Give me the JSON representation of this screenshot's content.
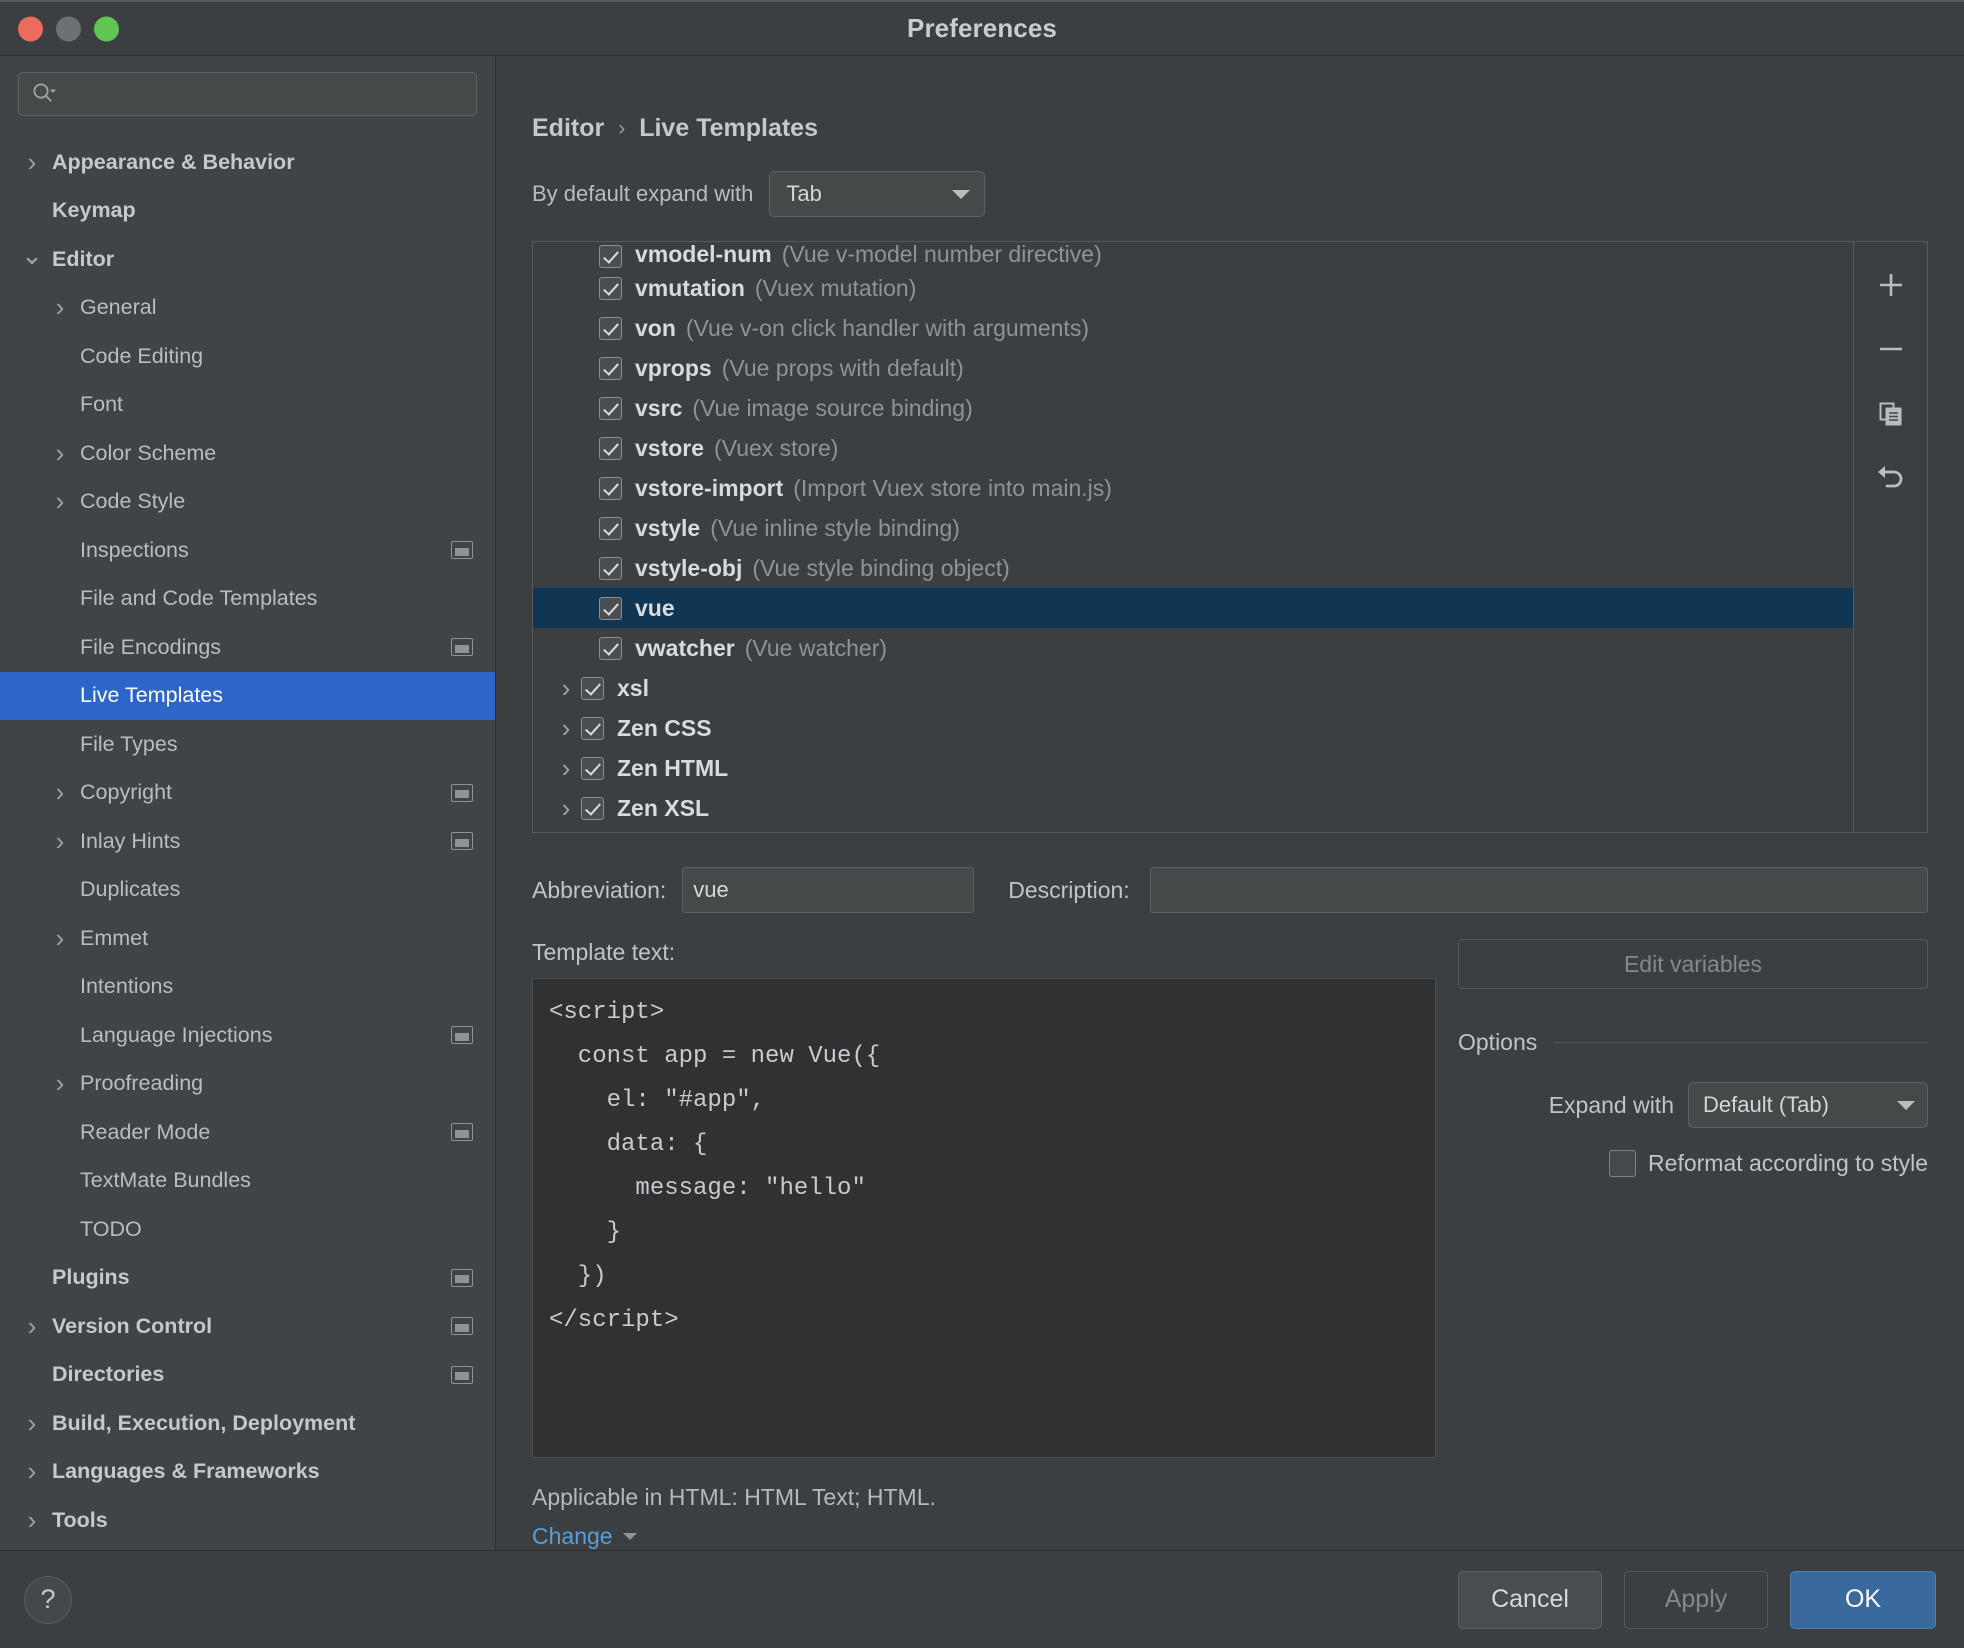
{
  "window": {
    "title": "Preferences",
    "traffic_lights": [
      "close",
      "minimize",
      "zoom"
    ]
  },
  "sidebar": {
    "search": {
      "value": "",
      "placeholder": ""
    },
    "items": [
      {
        "label": "Appearance & Behavior",
        "level": 0,
        "chevron": "right",
        "bold": true,
        "badge": false,
        "selected": false
      },
      {
        "label": "Keymap",
        "level": 0,
        "chevron": "none",
        "bold": true,
        "badge": false,
        "selected": false
      },
      {
        "label": "Editor",
        "level": 0,
        "chevron": "down",
        "bold": true,
        "badge": false,
        "selected": false
      },
      {
        "label": "General",
        "level": 1,
        "chevron": "right",
        "bold": false,
        "badge": false,
        "selected": false
      },
      {
        "label": "Code Editing",
        "level": 1,
        "chevron": "none",
        "bold": false,
        "badge": false,
        "selected": false
      },
      {
        "label": "Font",
        "level": 1,
        "chevron": "none",
        "bold": false,
        "badge": false,
        "selected": false
      },
      {
        "label": "Color Scheme",
        "level": 1,
        "chevron": "right",
        "bold": false,
        "badge": false,
        "selected": false
      },
      {
        "label": "Code Style",
        "level": 1,
        "chevron": "right",
        "bold": false,
        "badge": false,
        "selected": false
      },
      {
        "label": "Inspections",
        "level": 1,
        "chevron": "none",
        "bold": false,
        "badge": true,
        "selected": false
      },
      {
        "label": "File and Code Templates",
        "level": 1,
        "chevron": "none",
        "bold": false,
        "badge": false,
        "selected": false
      },
      {
        "label": "File Encodings",
        "level": 1,
        "chevron": "none",
        "bold": false,
        "badge": true,
        "selected": false
      },
      {
        "label": "Live Templates",
        "level": 1,
        "chevron": "none",
        "bold": false,
        "badge": false,
        "selected": true
      },
      {
        "label": "File Types",
        "level": 1,
        "chevron": "none",
        "bold": false,
        "badge": false,
        "selected": false
      },
      {
        "label": "Copyright",
        "level": 1,
        "chevron": "right",
        "bold": false,
        "badge": true,
        "selected": false
      },
      {
        "label": "Inlay Hints",
        "level": 1,
        "chevron": "right",
        "bold": false,
        "badge": true,
        "selected": false
      },
      {
        "label": "Duplicates",
        "level": 1,
        "chevron": "none",
        "bold": false,
        "badge": false,
        "selected": false
      },
      {
        "label": "Emmet",
        "level": 1,
        "chevron": "right",
        "bold": false,
        "badge": false,
        "selected": false
      },
      {
        "label": "Intentions",
        "level": 1,
        "chevron": "none",
        "bold": false,
        "badge": false,
        "selected": false
      },
      {
        "label": "Language Injections",
        "level": 1,
        "chevron": "none",
        "bold": false,
        "badge": true,
        "selected": false
      },
      {
        "label": "Proofreading",
        "level": 1,
        "chevron": "right",
        "bold": false,
        "badge": false,
        "selected": false
      },
      {
        "label": "Reader Mode",
        "level": 1,
        "chevron": "none",
        "bold": false,
        "badge": true,
        "selected": false
      },
      {
        "label": "TextMate Bundles",
        "level": 1,
        "chevron": "none",
        "bold": false,
        "badge": false,
        "selected": false
      },
      {
        "label": "TODO",
        "level": 1,
        "chevron": "none",
        "bold": false,
        "badge": false,
        "selected": false
      },
      {
        "label": "Plugins",
        "level": 0,
        "chevron": "none",
        "bold": true,
        "badge": true,
        "selected": false
      },
      {
        "label": "Version Control",
        "level": 0,
        "chevron": "right",
        "bold": true,
        "badge": true,
        "selected": false
      },
      {
        "label": "Directories",
        "level": 0,
        "chevron": "none",
        "bold": true,
        "badge": true,
        "selected": false
      },
      {
        "label": "Build, Execution, Deployment",
        "level": 0,
        "chevron": "right",
        "bold": true,
        "badge": false,
        "selected": false
      },
      {
        "label": "Languages & Frameworks",
        "level": 0,
        "chevron": "right",
        "bold": true,
        "badge": false,
        "selected": false
      },
      {
        "label": "Tools",
        "level": 0,
        "chevron": "right",
        "bold": true,
        "badge": false,
        "selected": false
      }
    ]
  },
  "main": {
    "breadcrumb": {
      "parent": "Editor",
      "separator": "›",
      "current": "Live Templates"
    },
    "expand_with": {
      "label": "By default expand with",
      "value": "Tab"
    },
    "list_toolbar": [
      {
        "name": "add",
        "glyph": "+"
      },
      {
        "name": "remove",
        "glyph": "−"
      },
      {
        "name": "duplicate",
        "glyph": "copy"
      },
      {
        "name": "revert",
        "glyph": "undo"
      }
    ],
    "templates": [
      {
        "name": "vmodel-num",
        "desc": "(Vue v-model number directive)",
        "checked": true,
        "group": false,
        "selected": false,
        "clipped": true
      },
      {
        "name": "vmutation",
        "desc": "(Vuex mutation)",
        "checked": true,
        "group": false,
        "selected": false,
        "clipped": false
      },
      {
        "name": "von",
        "desc": "(Vue v-on click handler with arguments)",
        "checked": true,
        "group": false,
        "selected": false,
        "clipped": false
      },
      {
        "name": "vprops",
        "desc": "(Vue props with default)",
        "checked": true,
        "group": false,
        "selected": false,
        "clipped": false
      },
      {
        "name": "vsrc",
        "desc": "(Vue image source binding)",
        "checked": true,
        "group": false,
        "selected": false,
        "clipped": false
      },
      {
        "name": "vstore",
        "desc": "(Vuex store)",
        "checked": true,
        "group": false,
        "selected": false,
        "clipped": false
      },
      {
        "name": "vstore-import",
        "desc": "(Import Vuex store into main.js)",
        "checked": true,
        "group": false,
        "selected": false,
        "clipped": false
      },
      {
        "name": "vstyle",
        "desc": "(Vue inline style binding)",
        "checked": true,
        "group": false,
        "selected": false,
        "clipped": false
      },
      {
        "name": "vstyle-obj",
        "desc": "(Vue style binding object)",
        "checked": true,
        "group": false,
        "selected": false,
        "clipped": false
      },
      {
        "name": "vue",
        "desc": "",
        "checked": true,
        "group": false,
        "selected": true,
        "clipped": false
      },
      {
        "name": "vwatcher",
        "desc": "(Vue watcher)",
        "checked": true,
        "group": false,
        "selected": false,
        "clipped": false
      },
      {
        "name": "xsl",
        "desc": "",
        "checked": true,
        "group": true,
        "selected": false,
        "clipped": false
      },
      {
        "name": "Zen CSS",
        "desc": "",
        "checked": true,
        "group": true,
        "selected": false,
        "clipped": false
      },
      {
        "name": "Zen HTML",
        "desc": "",
        "checked": true,
        "group": true,
        "selected": false,
        "clipped": false
      },
      {
        "name": "Zen XSL",
        "desc": "",
        "checked": true,
        "group": true,
        "selected": false,
        "clipped": false
      }
    ],
    "abbreviation": {
      "label": "Abbreviation:",
      "value": "vue"
    },
    "description": {
      "label": "Description:",
      "value": ""
    },
    "template_text": {
      "label": "Template text:",
      "value": "<script>\n  const app = new Vue({\n    el: \"#app\",\n    data: {\n      message: \"hello\"\n    }\n  })\n</script>"
    },
    "edit_variables_button": "Edit variables",
    "options": {
      "title": "Options",
      "expand_with": {
        "label": "Expand with",
        "value": "Default (Tab)"
      },
      "reformat": {
        "label": "Reformat according to style",
        "checked": false
      }
    },
    "applicable_text": "Applicable in HTML: HTML Text; HTML.",
    "change_link": "Change"
  },
  "footer": {
    "help": "?",
    "cancel": "Cancel",
    "apply": "Apply",
    "ok": "OK"
  },
  "colors": {
    "accent_selection": "#2e65c8",
    "list_selection": "#103654",
    "link": "#5b9dd9",
    "ok_button": "#3a699e",
    "window_bg": "#3c3f41",
    "sidebar_bg": "#3f4447",
    "code_bg": "#2f3133"
  }
}
